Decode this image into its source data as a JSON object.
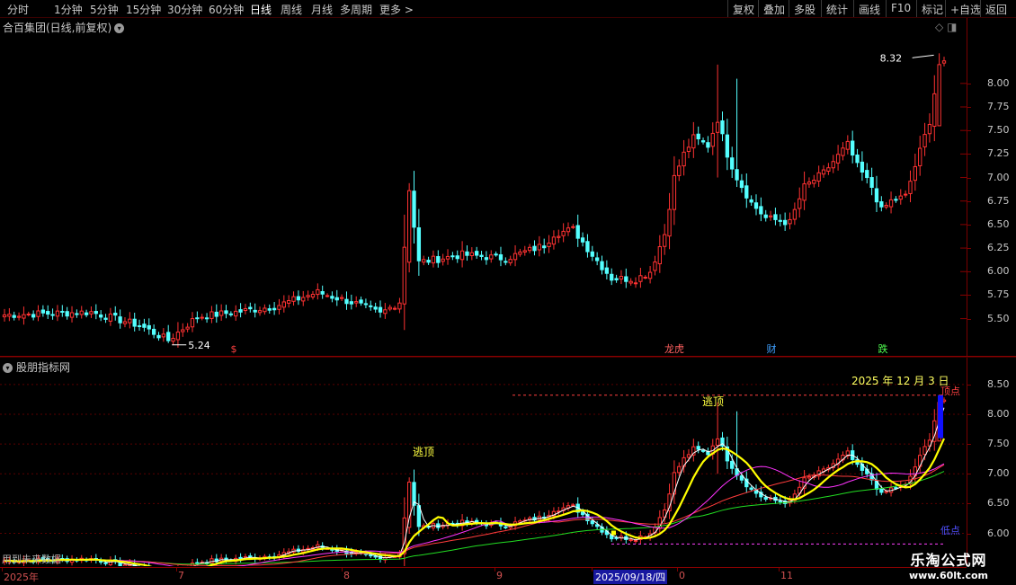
{
  "toolbar": {
    "left": [
      "分时",
      "1分钟",
      "5分钟",
      "15分钟",
      "30分钟",
      "60分钟",
      "日线",
      "周线",
      "月线",
      "多周期",
      "更多 >"
    ],
    "active_index": 6,
    "right": [
      "复权",
      "叠加",
      "多股",
      "统计",
      "画线",
      "F10",
      "标记",
      "+自选",
      "返回"
    ]
  },
  "top_pane": {
    "title": "合百集团(日线,前复权)",
    "menu_icon": "chevron-down-icon",
    "price_labels": {
      "high": "8.32",
      "low": "5.24"
    },
    "event_markers": [
      "$",
      "龙虎",
      "财",
      "跌"
    ],
    "axis_ticks": [
      "8.00",
      "7.75",
      "7.50",
      "7.25",
      "7.00",
      "6.75",
      "6.50",
      "6.25",
      "6.00",
      "5.75",
      "5.50"
    ]
  },
  "bottom_pane": {
    "title": "股朋指标网",
    "annotations": {
      "escape_top": "逃顶",
      "top_point": "顶点",
      "bottom_point": "低点",
      "date_banner": "2025 年 12 月 3 日"
    },
    "axis_ticks": [
      "8.50",
      "8.00",
      "7.50",
      "7.00",
      "6.50",
      "6.00"
    ],
    "footer_text": "用到未来数据"
  },
  "x_axis": {
    "labels": [
      "2025年",
      "7",
      "8",
      "9",
      "2025/09/18/四",
      "0",
      "11"
    ],
    "selected_label": "2025/09/18/四"
  },
  "watermark": {
    "line1": "乐淘公式网",
    "line2": "www.60lt.com"
  },
  "colors": {
    "background": "#000000",
    "up_candle": "#ff3232",
    "down_candle": "#54ffff",
    "grid": "#8a0000",
    "axis_text": "#c8c8c8",
    "line_white": "#ffffff",
    "line_yellow": "#ffff00",
    "line_magenta": "#ff33ff",
    "line_red": "#ff3c3c",
    "line_green": "#22dd22",
    "dashed_top": "#ff4040",
    "dashed_bottom": "#ff40ff",
    "signal_blue": "#1010ff",
    "watermark": "#ffffff"
  },
  "chart_data": {
    "type": "candlestick",
    "top": {
      "ylim": [
        5.2,
        8.6
      ],
      "high_marker": 8.32,
      "low_marker": 5.24
    },
    "bottom": {
      "ylim": [
        5.6,
        8.8
      ],
      "top_line": 8.32,
      "bottom_line": 5.82
    },
    "anchors": [
      [
        0,
        5.54
      ],
      [
        18,
        5.57
      ],
      [
        28,
        5.43
      ],
      [
        34,
        5.27
      ],
      [
        40,
        5.52
      ],
      [
        48,
        5.57
      ],
      [
        56,
        5.63
      ],
      [
        65,
        5.78
      ],
      [
        73,
        5.66
      ],
      [
        78,
        5.55
      ],
      [
        82,
        5.68
      ],
      [
        84,
        6.86
      ],
      [
        86,
        6.1
      ],
      [
        95,
        6.18
      ],
      [
        104,
        6.14
      ],
      [
        112,
        6.28
      ],
      [
        114,
        6.4
      ],
      [
        118,
        6.45
      ],
      [
        122,
        6.18
      ],
      [
        126,
        5.93
      ],
      [
        131,
        5.92
      ],
      [
        134,
        6.0
      ],
      [
        137,
        6.4
      ],
      [
        139,
        7.0
      ],
      [
        141,
        7.25
      ],
      [
        143,
        7.42
      ],
      [
        146,
        7.34
      ],
      [
        148,
        7.62
      ],
      [
        150,
        7.25
      ],
      [
        152,
        7.0
      ],
      [
        155,
        6.73
      ],
      [
        158,
        6.57
      ],
      [
        163,
        6.52
      ],
      [
        166,
        6.9
      ],
      [
        170,
        7.05
      ],
      [
        175,
        7.35
      ],
      [
        177,
        7.12
      ],
      [
        180,
        6.9
      ],
      [
        182,
        6.65
      ],
      [
        184,
        6.75
      ],
      [
        187,
        6.8
      ],
      [
        190,
        7.28
      ],
      [
        192,
        7.6
      ],
      [
        194,
        8.2
      ]
    ]
  }
}
